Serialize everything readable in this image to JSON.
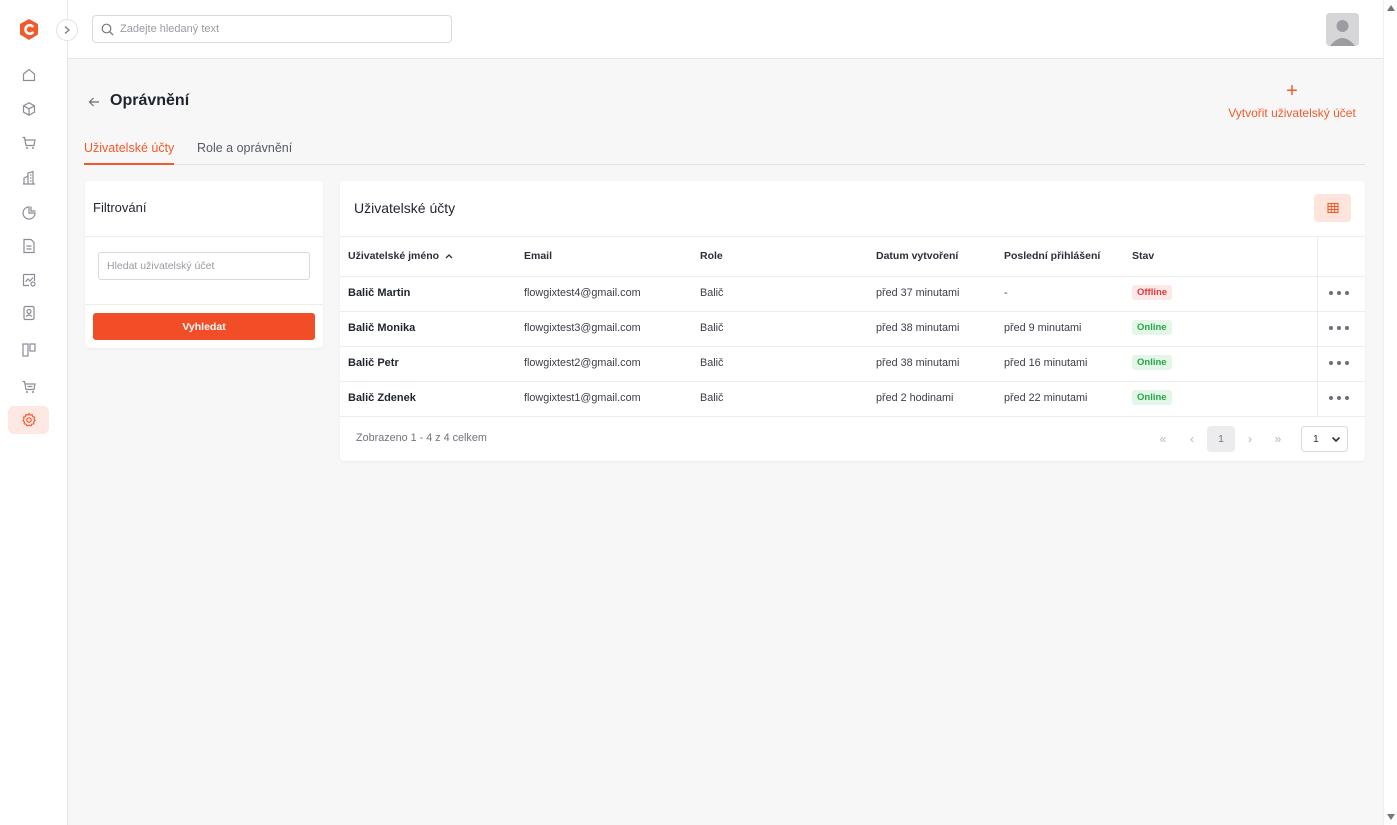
{
  "topbar": {
    "search_placeholder": "Zadejte hledaný text"
  },
  "colors": {
    "accent": "#f15a2b",
    "button": "#f14d27",
    "online": "#27a745",
    "offline": "#e03b3b"
  },
  "sidebar": {
    "items": [
      {
        "icon": "home-icon"
      },
      {
        "icon": "box-icon"
      },
      {
        "icon": "cart-icon"
      },
      {
        "icon": "building-icon"
      },
      {
        "icon": "pie-chart-icon"
      },
      {
        "icon": "document-icon"
      },
      {
        "icon": "analytics-icon"
      },
      {
        "icon": "contacts-icon"
      },
      {
        "icon": "kanban-icon"
      },
      {
        "icon": "cart-list-icon"
      },
      {
        "icon": "gear-icon",
        "active": true
      }
    ]
  },
  "page": {
    "title": "Oprávnění",
    "create_label": "Vytvořit uživatelský účet",
    "tabs": [
      {
        "label": "Uživatelské účty",
        "active": true
      },
      {
        "label": "Role a oprávnění",
        "active": false
      }
    ]
  },
  "filter": {
    "title": "Filtrování",
    "input_placeholder": "Hledat uživatelský účet",
    "button_label": "Vyhledat"
  },
  "table": {
    "title": "Uživatelské účty",
    "columns": [
      "Uživatelské jméno",
      "Email",
      "Role",
      "Datum vytvoření",
      "Poslední přihlášení",
      "Stav"
    ],
    "sort_column": "Uživatelské jméno",
    "rows": [
      {
        "name": "Balič Martin",
        "email": "flowgixtest4@gmail.com",
        "role": "Balič",
        "created": "před 37 minutami",
        "last_login": "-",
        "status": "Offline"
      },
      {
        "name": "Balič Monika",
        "email": "flowgixtest3@gmail.com",
        "role": "Balič",
        "created": "před 38 minutami",
        "last_login": "před 9 minutami",
        "status": "Online"
      },
      {
        "name": "Balič Petr",
        "email": "flowgixtest2@gmail.com",
        "role": "Balič",
        "created": "před 38 minutami",
        "last_login": "před 16 minutami",
        "status": "Online"
      },
      {
        "name": "Balič Zdenek",
        "email": "flowgixtest1@gmail.com",
        "role": "Balič",
        "created": "před 2 hodinami",
        "last_login": "před 22 minutami",
        "status": "Online"
      }
    ],
    "summary": "Zobrazeno 1 - 4 z 4 celkem",
    "pager": {
      "first": "«",
      "prev": "‹",
      "current": "1",
      "next": "›",
      "last": "»",
      "page_select_value": "1"
    }
  }
}
